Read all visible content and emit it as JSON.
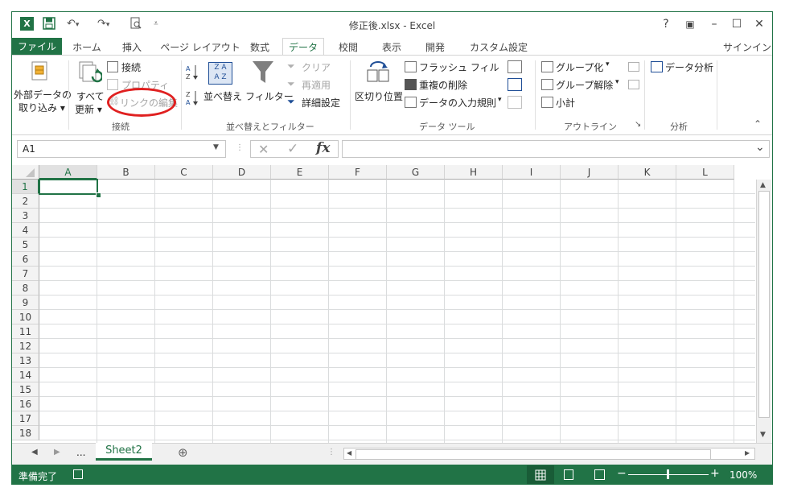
{
  "window": {
    "title": "修正後.xlsx - Excel"
  },
  "titlebar": {
    "help": "?",
    "ribbon_options": "▣",
    "minimize": "–",
    "maximize": "☐",
    "close": "✕",
    "signin": "サインイン"
  },
  "tabs": [
    {
      "label": "ファイル"
    },
    {
      "label": "ホーム"
    },
    {
      "label": "挿入"
    },
    {
      "label": "ページ レイアウト"
    },
    {
      "label": "数式"
    },
    {
      "label": "データ"
    },
    {
      "label": "校閲"
    },
    {
      "label": "表示"
    },
    {
      "label": "開発"
    },
    {
      "label": "カスタム設定"
    }
  ],
  "ribbon": {
    "external": {
      "line1": "外部データの",
      "line2": "取り込み ▾"
    },
    "refresh": {
      "line1": "すべて",
      "line2": "更新 ▾"
    },
    "connections": {
      "connect": "接続",
      "properties": "プロパティ",
      "edit_links": "リンクの編集",
      "label": "接続"
    },
    "sort": {
      "az": "A↓Z",
      "za": "Z↓A",
      "sort": "並べ替え",
      "filter": "フィルター",
      "clear": "クリア",
      "reapply": "再適用",
      "advanced": "詳細設定",
      "label": "並べ替えとフィルター"
    },
    "tools": {
      "split": "区切り位置",
      "flash": "フラッシュ フィル",
      "dup": "重複の削除",
      "validation": "データの入力規則",
      "validation_arrow": "▾",
      "label": "データ ツール"
    },
    "outline": {
      "group": "グループ化",
      "ungroup": "グループ解除",
      "subtotal": "小計",
      "arrow": "▾",
      "label": "アウトライン",
      "launcher": "↘"
    },
    "analysis": {
      "analyze": "データ分析",
      "label": "分析"
    },
    "collapse": "⌃"
  },
  "formula": {
    "namebox": "A1",
    "fx": "fx",
    "cancel": "✕",
    "enter": "✓",
    "expand": "⌄"
  },
  "grid": {
    "columns": [
      "A",
      "B",
      "C",
      "D",
      "E",
      "F",
      "G",
      "H",
      "I",
      "J",
      "K",
      "L"
    ],
    "rows": [
      "1",
      "2",
      "3",
      "4",
      "5",
      "6",
      "7",
      "8",
      "9",
      "10",
      "11",
      "12",
      "13",
      "14",
      "15",
      "16",
      "17",
      "18"
    ]
  },
  "sheets": {
    "more": "...",
    "active": "Sheet2",
    "add": "⊕"
  },
  "status": {
    "ready": "準備完了",
    "zoom": "100%",
    "minus": "−",
    "plus": "+"
  },
  "colors": {
    "accent": "#217346",
    "annotation": "#e02020"
  }
}
